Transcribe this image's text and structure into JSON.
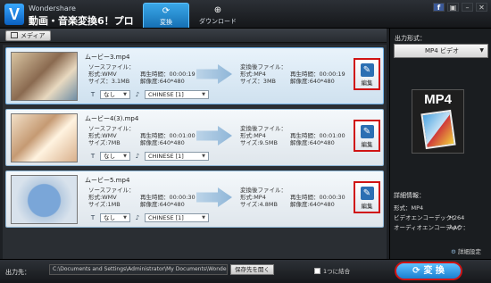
{
  "app": {
    "brand": "Wondershare",
    "title": "動画・音楽変換6！プロ"
  },
  "tabs": [
    {
      "label": "変換",
      "active": true
    },
    {
      "label": "ダウンロード",
      "active": false
    }
  ],
  "window_controls": [
    "f",
    "▣",
    "–",
    "✕"
  ],
  "toolbar": {
    "media_button": "メディア"
  },
  "items": [
    {
      "filename": "ムービー3.mp4",
      "source": {
        "label": "ソースファイル：",
        "format": "形式:WMV",
        "size": "サイズ：3.1MB",
        "duration": "再生時間：00:00:19",
        "resolution": "解像度:640*480"
      },
      "output": {
        "label": "変換後ファイル：",
        "format": "形式:MP4",
        "size": "サイズ：3MB",
        "duration": "再生時間：00:00:19",
        "resolution": "解像度:640*480"
      },
      "subtitle": "なし",
      "audio": "CHINESE [1]",
      "edit_label": "編集",
      "selected": true
    },
    {
      "filename": "ムービー4(3).mp4",
      "source": {
        "label": "ソースファイル：",
        "format": "形式:WMV",
        "size": "サイズ:7MB",
        "duration": "再生時間：00:01:00",
        "resolution": "解像度:640*480"
      },
      "output": {
        "label": "変換後ファイル：",
        "format": "形式:MP4",
        "size": "サイズ:9.5MB",
        "duration": "再生時間：00:01:00",
        "resolution": "解像度:640*480"
      },
      "subtitle": "なし",
      "audio": "CHINESE [1]",
      "edit_label": "編集",
      "selected": false
    },
    {
      "filename": "ムービー5.mp4",
      "source": {
        "label": "ソースファイル：",
        "format": "形式:WMV",
        "size": "サイズ:1MB",
        "duration": "再生時間：00:00:30",
        "resolution": "解像度:640*480"
      },
      "output": {
        "label": "変換後ファイル：",
        "format": "形式:MP4",
        "size": "サイズ:4.8MB",
        "duration": "再生時間：00:00:30",
        "resolution": "解像度:640*480"
      },
      "subtitle": "なし",
      "audio": "CHINESE [1]",
      "edit_label": "編集",
      "selected": false
    }
  ],
  "right_panel": {
    "output_format_label": "出力形式：",
    "format_value": "MP4 ビデオ",
    "format_icon_text": "MP4",
    "detail_label": "詳細情報：",
    "details": [
      {
        "key": "形式：MP4",
        "value": ""
      },
      {
        "key": "ビデオエンコーデック：",
        "value": "H264"
      },
      {
        "key": "オーディオエンコーデック：",
        "value": "AAC"
      }
    ],
    "settings_link": "詳細設定"
  },
  "bottom": {
    "output_label": "出力先：",
    "path": "C:\\Documents and Settings\\Administrator\\My Documents\\Wondershare \\ ...",
    "open_button": "保存先を開く",
    "merge_label": "1つに結合",
    "convert_button": "変 換"
  },
  "colors": {
    "accent": "#1a7fd0",
    "highlight": "#d01414"
  }
}
